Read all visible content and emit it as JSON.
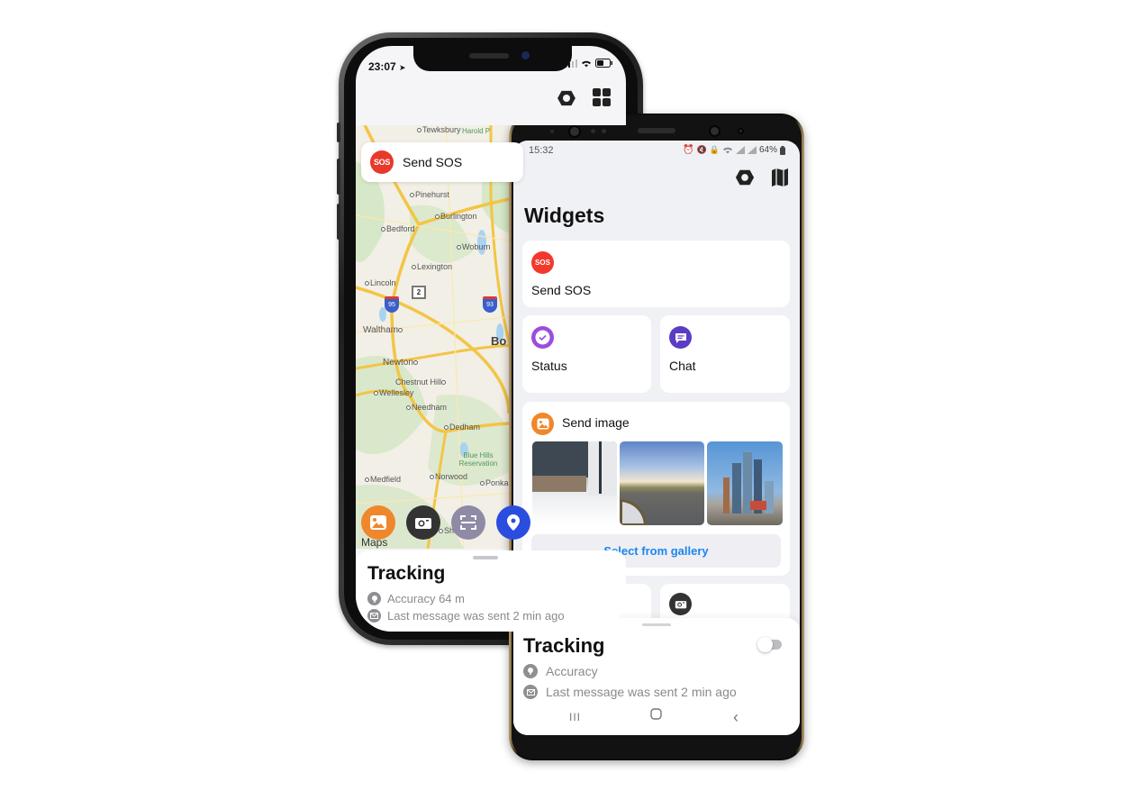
{
  "iphone": {
    "status": {
      "time": "23:07",
      "location_icon": "location-arrow-icon",
      "signal_icon": "signal-icon",
      "wifi_icon": "wifi-icon",
      "battery_icon": "battery-icon"
    },
    "toolbar": {
      "settings_icon": "hexagon-settings-icon",
      "widgets_icon": "grid-icon"
    },
    "sos_card": {
      "badge": "SOS",
      "label": "Send SOS"
    },
    "map": {
      "labels": [
        "Tewksbury",
        "Pinehurst",
        "Burlington",
        "Bedford",
        "Woburn",
        "Lexington",
        "Lincoln",
        "Waltham",
        "Bo",
        "Newton",
        "Chestnut Hill",
        "Wellesley",
        "Needham",
        "Dedham",
        "Blue Hills Reservation",
        "Medfield",
        "Norwood",
        "Ponkapo",
        "Sharon",
        "Harold P"
      ],
      "shields": [
        "95",
        "93",
        "2"
      ],
      "attribution": "Maps"
    },
    "quick_actions": [
      {
        "name": "send-image",
        "icon": "image-icon",
        "color": "#f0872b"
      },
      {
        "name": "camera",
        "icon": "camera-icon",
        "color": "#333333"
      },
      {
        "name": "scan",
        "icon": "scan-icon",
        "color": "#8f8aa5"
      },
      {
        "name": "location",
        "icon": "location-pin-icon",
        "color": "#2a4de0"
      }
    ],
    "tracking": {
      "title": "Tracking",
      "accuracy": "Accuracy 64 m",
      "last_message": "Last message was sent 2 min ago"
    }
  },
  "android": {
    "status": {
      "time": "15:32",
      "battery": "64%"
    },
    "toolbar": {
      "settings_icon": "hexagon-settings-icon",
      "map_icon": "map-icon"
    },
    "title": "Widgets",
    "widgets": {
      "sos": {
        "badge": "SOS",
        "label": "Send SOS",
        "color": "#f2392c"
      },
      "status": {
        "label": "Status",
        "color": "#9b4ddb"
      },
      "chat": {
        "label": "Chat",
        "color": "#5b3cc4"
      },
      "send_image": {
        "label": "Send image",
        "color": "#f0872b",
        "thumbnails": [
          "snowy-porch-photo",
          "road-sunset-photo",
          "city-skyline-photo"
        ],
        "gallery_button": "Select from gallery"
      },
      "scan": {
        "color": "#8f8aa5"
      },
      "camera": {
        "color": "#333333"
      }
    },
    "tracking": {
      "title": "Tracking",
      "toggle_on": false,
      "accuracy": "Accuracy",
      "last_message": "Last message was sent 2 min ago"
    },
    "navbar": {
      "recents": "III",
      "home": "○",
      "back": "‹"
    }
  },
  "colors": {
    "sos_red": "#e8392b",
    "link_blue": "#1a86ee",
    "muted_grey": "#8a8a8e"
  }
}
